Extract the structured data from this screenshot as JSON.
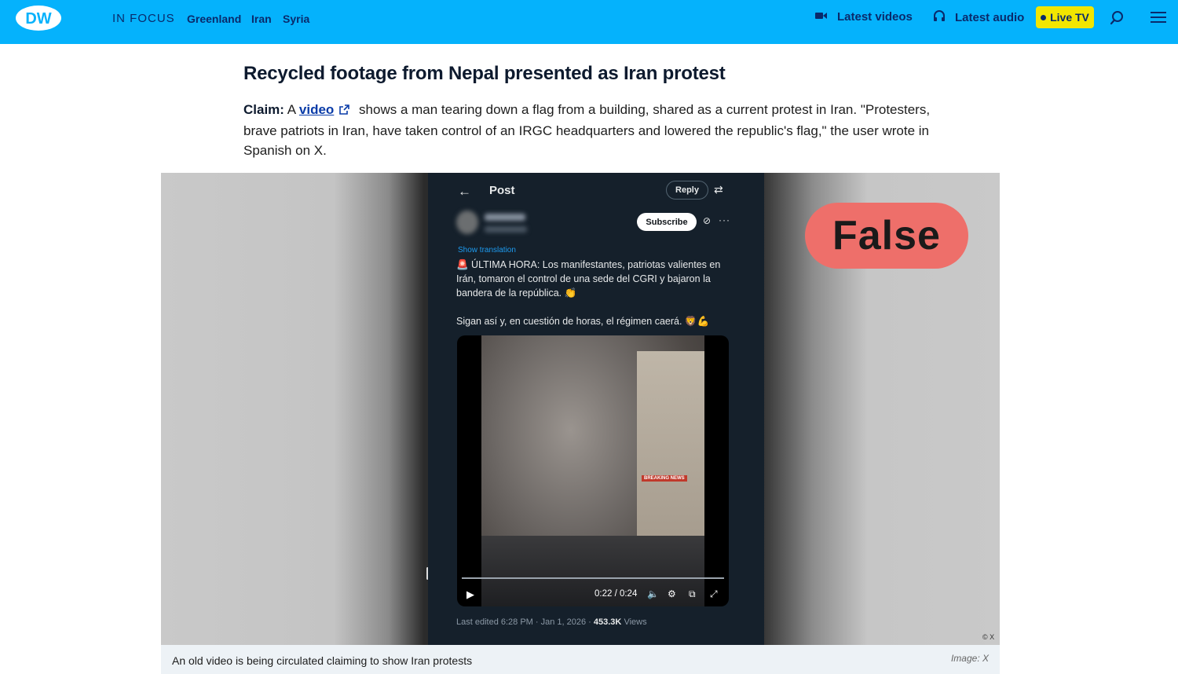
{
  "colors": {
    "nav_bg": "#05b2fc",
    "nav_text": "#0a2a6b",
    "live_bg": "#f2e600",
    "verdict_bg": "#ee6f6a",
    "link": "#0a3ca8",
    "tweet_bg": "#15202b"
  },
  "nav": {
    "logo": "DW",
    "in_focus": "IN FOCUS",
    "topics": [
      "Greenland",
      "Iran",
      "Syria"
    ],
    "latest_videos": "Latest videos",
    "latest_audio": "Latest audio",
    "live_tv": "Live TV",
    "icons": [
      "video-camera-icon",
      "headphones-icon",
      "search-icon",
      "menu-icon"
    ]
  },
  "article": {
    "headline": "Recycled footage from Nepal presented as Iran protest",
    "claim_label": "Claim:",
    "claim_pre": "A",
    "claim_link": "video",
    "claim_post": "shows a man tearing down a flag from a building, shared as a current protest in Iran. \"Protesters, brave patriots in Iran, have taken control of an IRGC headquarters and lowered the republic's flag,\" the user wrote in Spanish on X."
  },
  "figure": {
    "verdict": "False",
    "copyright": "© X",
    "caption": "An old video is being circulated claiming to show Iran protests",
    "credit": "Image: X",
    "tweet": {
      "back": "←",
      "title": "Post",
      "reply": "Reply",
      "subscribe": "Subscribe",
      "show_translation": "Show translation",
      "text1": "🚨 ÚLTIMA HORA: Los manifestantes, patriotas valientes en Irán, tomaron el control de una sede del CGRI y bajaron la bandera de la república. 👏",
      "text2": "Sigan así y, en cuestión de horas, el régimen caerá. 🦁💪",
      "video_time": "0:22 / 0:24",
      "breaking": "BREAKING NEWS",
      "footer_date": "Last edited 6:28 PM · Jan 1, 2026 ·",
      "footer_views": "453.3K",
      "footer_views_label": "Views"
    }
  }
}
